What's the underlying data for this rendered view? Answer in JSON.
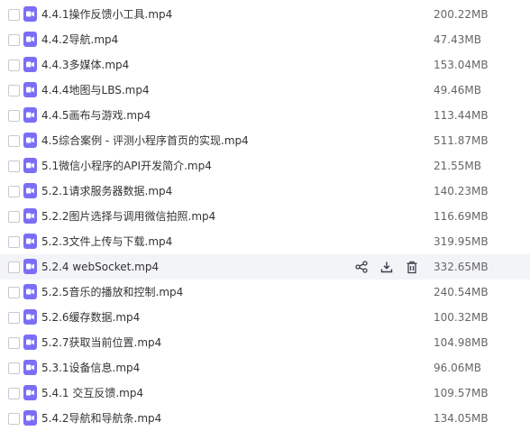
{
  "files": [
    {
      "name": "4.4.1操作反馈小工具.mp4",
      "size": "200.22MB",
      "icon": "video-file-icon"
    },
    {
      "name": "4.4.2导航.mp4",
      "size": "47.43MB",
      "icon": "video-file-icon"
    },
    {
      "name": "4.4.3多媒体.mp4",
      "size": "153.04MB",
      "icon": "video-file-icon"
    },
    {
      "name": "4.4.4地图与LBS.mp4",
      "size": "49.46MB",
      "icon": "video-file-icon"
    },
    {
      "name": "4.4.5画布与游戏.mp4",
      "size": "113.44MB",
      "icon": "video-file-icon"
    },
    {
      "name": "4.5综合案例 - 评测小程序首页的实现.mp4",
      "size": "511.87MB",
      "icon": "video-file-icon"
    },
    {
      "name": "5.1微信小程序的API开发简介.mp4",
      "size": "21.55MB",
      "icon": "video-file-icon"
    },
    {
      "name": "5.2.1请求服务器数据.mp4",
      "size": "140.23MB",
      "icon": "video-file-icon"
    },
    {
      "name": "5.2.2图片选择与调用微信拍照.mp4",
      "size": "116.69MB",
      "icon": "video-file-icon"
    },
    {
      "name": "5.2.3文件上传与下载.mp4",
      "size": "319.95MB",
      "icon": "video-file-icon"
    },
    {
      "name": "5.2.4 webSocket.mp4",
      "size": "332.65MB",
      "icon": "video-file-icon"
    },
    {
      "name": "5.2.5音乐的播放和控制.mp4",
      "size": "240.54MB",
      "icon": "video-file-icon"
    },
    {
      "name": "5.2.6缓存数据.mp4",
      "size": "100.32MB",
      "icon": "video-file-icon"
    },
    {
      "name": "5.2.7获取当前位置.mp4",
      "size": "104.98MB",
      "icon": "video-file-icon"
    },
    {
      "name": "5.3.1设备信息.mp4",
      "size": "96.06MB",
      "icon": "video-file-icon"
    },
    {
      "name": "5.4.1 交互反馈.mp4",
      "size": "109.57MB",
      "icon": "video-file-icon"
    },
    {
      "name": "5.4.2导航和导航条.mp4",
      "size": "134.05MB",
      "icon": "video-file-icon"
    }
  ],
  "hovered_row_index": 10,
  "row_actions": [
    "share-icon",
    "download-icon",
    "delete-icon"
  ],
  "colors": {
    "file_icon": "#7b6ef6",
    "hover_background": "#f3f4f8",
    "name_text": "#333333",
    "size_text": "#666666",
    "action_icon": "#3a3f4b"
  }
}
